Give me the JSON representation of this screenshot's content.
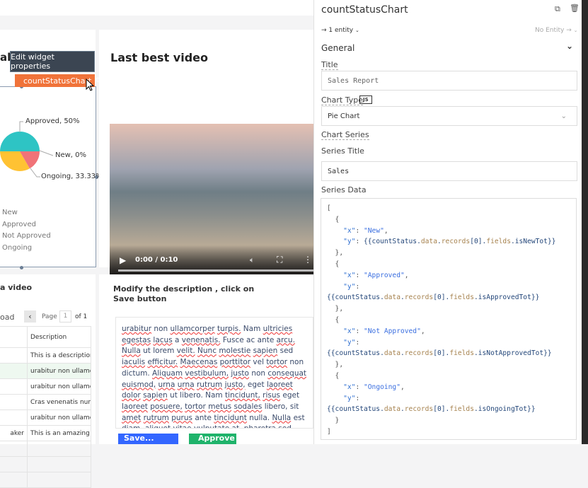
{
  "canvas": {
    "chart_widget": {
      "partial_title": "ab",
      "tooltip": "Edit widget properties",
      "name_tag": "countStatusChart",
      "chart_data": {
        "type": "pie",
        "slices": [
          {
            "label": "New",
            "value": 0,
            "color": "#2ec4c4"
          },
          {
            "label": "Approved",
            "value": 50,
            "color": "#2ec4c4"
          },
          {
            "label": "Not Approved",
            "value": 16.67,
            "color": "#f07378"
          },
          {
            "label": "Ongoing",
            "value": 33.33,
            "color": "#ffc233"
          }
        ],
        "data_labels": [
          "Approved, 50%",
          "New, 0%",
          "Ongoing, 33.33%"
        ],
        "legend": [
          "New",
          "Approved",
          "Not Approved",
          "Ongoing"
        ]
      }
    },
    "video_widget": {
      "title": "Last best video",
      "time": "0:00 / 0:10"
    },
    "table_widget": {
      "partial_title": "a video",
      "partial_button": "oad",
      "page_label": "Page",
      "page_value": "1",
      "page_of": "of 1",
      "column": "Description",
      "rows": [
        [
          "",
          "This is a description"
        ],
        [
          "",
          "urabitur non ullamco"
        ],
        [
          "",
          "urabitur non ullamco"
        ],
        [
          "",
          "Cras venenatis nunc"
        ],
        [
          "",
          "urabitur non ullamco"
        ],
        [
          "aker",
          "This is an amazing vi"
        ],
        [
          "",
          ""
        ],
        [
          "",
          ""
        ],
        [
          "",
          ""
        ]
      ]
    },
    "desc_widget": {
      "instruction": "Modify the description , click on Save button",
      "text": "urabitur non ullamcorper turpis. Nam ultricies egestas lacus a venenatis. Fusce ac ante arcu. Nulla ut lorem velit. Nunc molestie sapien sed iaculis efficitur. Maecenas porttitor vel tortor non dictum. Aliquam vestibulum, justo non consequat euismod, urna urna rutrum justo, eget laoreet dolor sapien ut libero. Nam tincidunt, risus eget laoreet posuere, tortor metus sodales libero, sit amet rutrum purus ante tincidunt nulla. Nulla est diam, aliquet vitae vulputate at, pharetra sed mauris. Pellentesque ac lacus et ante sagittis porta. Morbi",
      "save": "Save...",
      "approve": "Approve"
    }
  },
  "panel": {
    "title": "countStatusChart",
    "entity_in": "→ 1 entity",
    "entity_out": "No Entity →",
    "section": "General",
    "title_label": "Title",
    "title_value": "Sales Report",
    "chart_type_label": "Chart Type",
    "js_badge": "JS",
    "chart_type_value": "Pie Chart",
    "series_label": "Chart Series",
    "series_title_label": "Series Title",
    "series_title_value": "Sales",
    "series_data_label": "Series Data",
    "series_data_lines": [
      [
        [
          "p",
          "["
        ]
      ],
      [
        [
          "p",
          "  {"
        ]
      ],
      [
        [
          "k",
          "    \"x\""
        ],
        [
          "p",
          ": "
        ],
        [
          "s",
          "\"New\""
        ],
        [
          "p",
          ","
        ]
      ],
      [
        [
          "k",
          "    \"y\""
        ],
        [
          "p",
          ": "
        ],
        [
          "v",
          "{{countStatus."
        ],
        [
          "f",
          "data"
        ],
        [
          "v",
          "."
        ],
        [
          "f",
          "records"
        ],
        [
          "v",
          "[0]."
        ],
        [
          "f",
          "fields"
        ],
        [
          "v",
          ".isNewTot}}"
        ]
      ],
      [
        [
          "p",
          "  },"
        ]
      ],
      [
        [
          "p",
          "  {"
        ]
      ],
      [
        [
          "k",
          "    \"x\""
        ],
        [
          "p",
          ": "
        ],
        [
          "s",
          "\"Approved\""
        ],
        [
          "p",
          ","
        ]
      ],
      [
        [
          "k",
          "    \"y\""
        ],
        [
          "p",
          ":"
        ]
      ],
      [
        [
          "v",
          "{{countStatus."
        ],
        [
          "f",
          "data"
        ],
        [
          "v",
          "."
        ],
        [
          "f",
          "records"
        ],
        [
          "v",
          "[0]."
        ],
        [
          "f",
          "fields"
        ],
        [
          "v",
          ".isApprovedTot}}"
        ]
      ],
      [
        [
          "p",
          "  },"
        ]
      ],
      [
        [
          "p",
          "  {"
        ]
      ],
      [
        [
          "k",
          "    \"x\""
        ],
        [
          "p",
          ": "
        ],
        [
          "s",
          "\"Not Approved\""
        ],
        [
          "p",
          ","
        ]
      ],
      [
        [
          "k",
          "    \"y\""
        ],
        [
          "p",
          ":"
        ]
      ],
      [
        [
          "v",
          "{{countStatus."
        ],
        [
          "f",
          "data"
        ],
        [
          "v",
          "."
        ],
        [
          "f",
          "records"
        ],
        [
          "v",
          "[0]."
        ],
        [
          "f",
          "fields"
        ],
        [
          "v",
          ".isNotApprovedTot}}"
        ]
      ],
      [
        [
          "p",
          "  },"
        ]
      ],
      [
        [
          "p",
          "  {"
        ]
      ],
      [
        [
          "k",
          "    \"x\""
        ],
        [
          "p",
          ": "
        ],
        [
          "s",
          "\"Ongoing\""
        ],
        [
          "p",
          ","
        ]
      ],
      [
        [
          "k",
          "    \"y\""
        ],
        [
          "p",
          ":"
        ]
      ],
      [
        [
          "v",
          "{{countStatus."
        ],
        [
          "f",
          "data"
        ],
        [
          "v",
          "."
        ],
        [
          "f",
          "records"
        ],
        [
          "v",
          "[0]."
        ],
        [
          "f",
          "fields"
        ],
        [
          "v",
          ".isOngoingTot}}"
        ]
      ],
      [
        [
          "p",
          "  }"
        ]
      ],
      [
        [
          "p",
          "]"
        ]
      ]
    ]
  }
}
